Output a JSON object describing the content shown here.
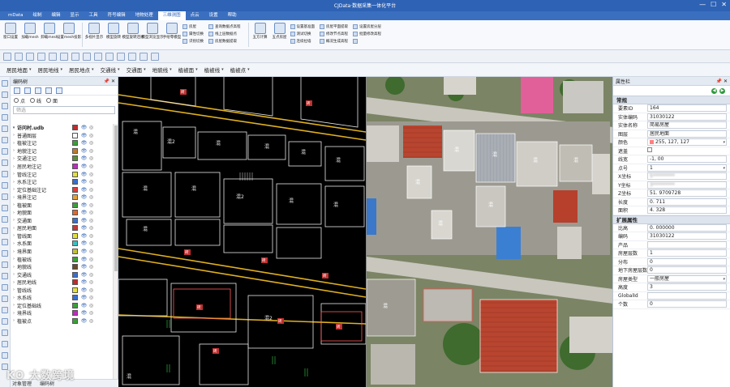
{
  "window": {
    "app_tab": "mData",
    "title": "CJData·数据采集一体化平台",
    "controls": [
      "—",
      "☐",
      "✕"
    ]
  },
  "menu": [
    "mData",
    "绘制",
    "编辑",
    "显示",
    "工具",
    "符号编辑",
    "地物处理",
    "三维测图",
    "点云",
    "设置",
    "帮助"
  ],
  "menu_active": 7,
  "ribbon": {
    "big": [
      {
        "label": "窗口设置"
      },
      {
        "label": "加载mesh"
      },
      {
        "label": "卸载mesh"
      },
      {
        "label": "设置mesh投影"
      },
      {
        "label": "多视片显示"
      },
      {
        "label": "模型旋转"
      },
      {
        "label": "模型旋转还原"
      },
      {
        "label": "模型浏览显示"
      },
      {
        "label": "手绘零模型"
      }
    ],
    "small_group_1": [
      "房屋",
      "属性切换",
      "识别切换"
    ],
    "small_group_2": [
      "查询数据点高程",
      "线上层数据点",
      "房屋数据提取"
    ],
    "big_2": [
      {
        "label": "五方计算"
      },
      {
        "label": "五点房屋"
      }
    ],
    "small_group_3": [
      "设置基准面",
      "测试切换",
      "连续拉墙"
    ],
    "small_group_4": [
      "房屋平面提取",
      "修改节点高程",
      "概况生成高程"
    ],
    "small_group_5": [
      "设置房屋分层",
      "批量修改高程",
      ""
    ]
  },
  "layer_bar": [
    "居民地面",
    "居民地线",
    "居民地点",
    "交通线",
    "交通面",
    "地貌线",
    "植被面",
    "植被线",
    "植被点"
  ],
  "layer_panel": {
    "title": "编码树",
    "radio": [
      "点",
      "线",
      "面"
    ],
    "filter_placeholder": "筛选",
    "root": "访问村.udb",
    "rows": [
      {
        "name": "普通图层",
        "color": "#ffffff"
      },
      {
        "name": "植被注记",
        "color": "#3aa037"
      },
      {
        "name": "地貌注记",
        "color": "#c07a2b"
      },
      {
        "name": "交通注记",
        "color": "#5a8e3a"
      },
      {
        "name": "居民地注记",
        "color": "#c02cc0"
      },
      {
        "name": "管线注记",
        "color": "#e2e23a"
      },
      {
        "name": "水系注记",
        "color": "#3a6fd0"
      },
      {
        "name": "定位基础注记",
        "color": "#e23a3a"
      },
      {
        "name": "境界注记",
        "color": "#e2a03a"
      },
      {
        "name": "植被面",
        "color": "#3aa037"
      },
      {
        "name": "地貌面",
        "color": "#e06a2a"
      },
      {
        "name": "交通面",
        "color": "#3a6fd0"
      },
      {
        "name": "居民地面",
        "color": "#c03a3a"
      },
      {
        "name": "管线面",
        "color": "#e2e23a"
      },
      {
        "name": "水系面",
        "color": "#3ac0c0"
      },
      {
        "name": "境界面",
        "color": "#c0c03a"
      },
      {
        "name": "植被线",
        "color": "#3aa037"
      },
      {
        "name": "地貌线",
        "color": "#6a4a2a"
      },
      {
        "name": "交通线",
        "color": "#3a6fd0"
      },
      {
        "name": "居民地线",
        "color": "#c02c2c"
      },
      {
        "name": "管线线",
        "color": "#e2e23a"
      },
      {
        "name": "水系线",
        "color": "#3a6fd0"
      },
      {
        "name": "定位基础线",
        "color": "#3aa037"
      },
      {
        "name": "境界线",
        "color": "#c02cc0"
      },
      {
        "name": "植被点",
        "color": "#3aa037"
      }
    ],
    "bottom_tabs": [
      "对象管理",
      "编码树"
    ]
  },
  "property_panel": {
    "title": "属性栏",
    "section_common": "常规",
    "common": [
      {
        "k": "要素ID",
        "v": "164"
      },
      {
        "k": "实体编码",
        "v": "31030122"
      },
      {
        "k": "实体名称",
        "v": "简易房屋"
      },
      {
        "k": "图层",
        "v": "居民地面"
      },
      {
        "k": "颜色",
        "v": "255, 127, 127"
      },
      {
        "k": "遮盖",
        "v": ""
      },
      {
        "k": "线宽",
        "v": "-1, 00"
      },
      {
        "k": "点号",
        "v": "1"
      },
      {
        "k": "X坐标",
        "v": "5*********"
      },
      {
        "k": "Y坐标",
        "v": "3*********"
      },
      {
        "k": "Z坐标",
        "v": "51. 9709728"
      },
      {
        "k": "长度",
        "v": "0. 711"
      },
      {
        "k": "面积",
        "v": "4. 328"
      }
    ],
    "section_ext": "扩展属性",
    "ext": [
      {
        "k": "比高",
        "v": "0. 000000"
      },
      {
        "k": "编码",
        "v": "31030122"
      },
      {
        "k": "产品",
        "v": ""
      },
      {
        "k": "房屋层数",
        "v": "1"
      },
      {
        "k": "分布",
        "v": "0"
      },
      {
        "k": "地下房屋层数",
        "v": "0"
      },
      {
        "k": "房屋类型",
        "v": "一般房屋"
      },
      {
        "k": "高度",
        "v": "3"
      },
      {
        "k": "GlobalId",
        "v": ""
      },
      {
        "k": "个数",
        "v": "0"
      }
    ]
  },
  "cad": {
    "labels": [
      "混",
      "混2",
      "混",
      "混",
      "混",
      "混",
      "混",
      "混",
      "混2",
      "混",
      "混",
      "混",
      "混2",
      "混"
    ],
    "marks": [
      "砖",
      "砖",
      "砖",
      "砖",
      "砖",
      "砖",
      "砖",
      "砖",
      "砖"
    ]
  },
  "imagery": {
    "labels": [
      "混",
      "混",
      "混",
      "混",
      "混",
      "混",
      "混",
      "混"
    ]
  },
  "watermark": "KO 大数跨境"
}
